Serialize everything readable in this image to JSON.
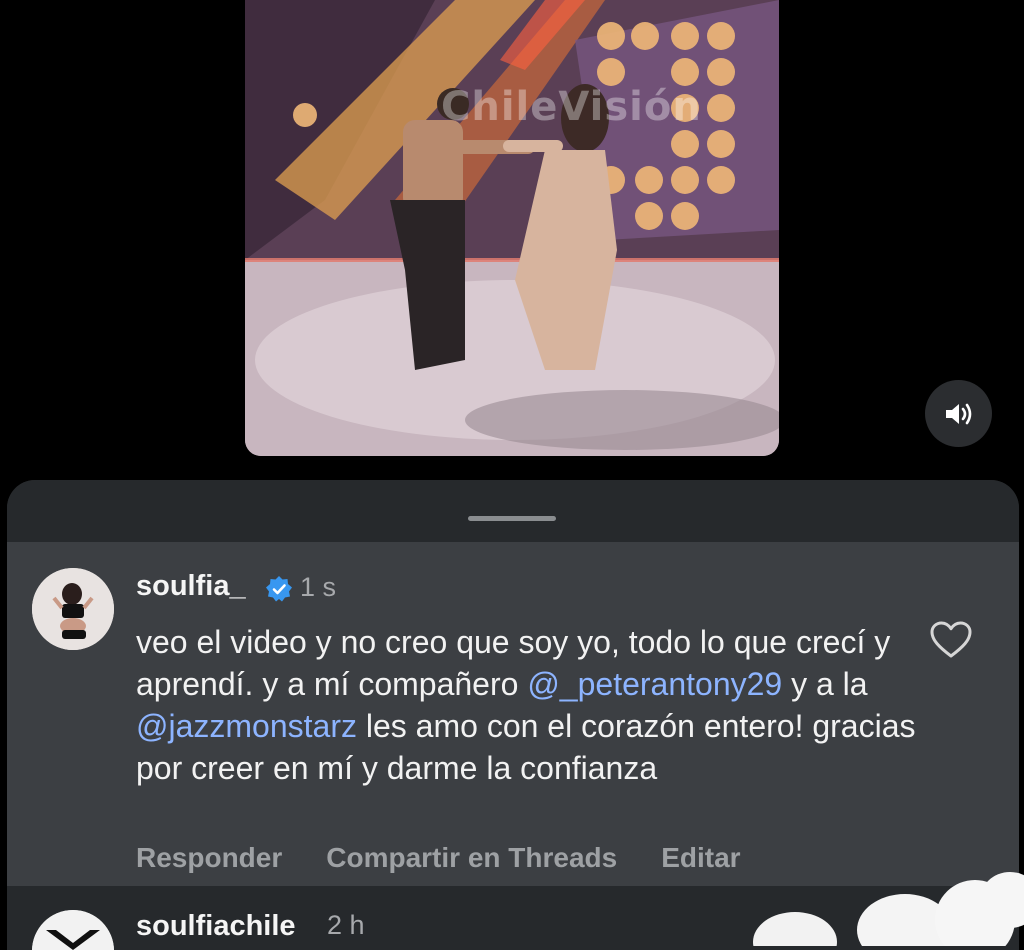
{
  "video": {
    "watermark": "ChileVisión",
    "sound_icon": "speaker-icon"
  },
  "comment": {
    "username": "soulfia_",
    "verified_icon": "verified-badge-icon",
    "time": "1 s",
    "text_parts": [
      "veo el video y no creo que soy yo, todo lo que crecí y aprendí. y a mí compañero ",
      "@_peterantony29",
      " y a la ",
      "@jazzmonstarz",
      " les amo con el corazón entero! gracias por creer en mí y darme la confianza"
    ],
    "like_icon": "heart-outline-icon",
    "actions": {
      "reply": "Responder",
      "share": "Compartir en Threads",
      "edit": "Editar"
    }
  },
  "next_comment": {
    "username": "soulfiachile",
    "time": "2 h"
  },
  "colors": {
    "sheet_bg": "#26292c",
    "highlight_bg": "#3c3f43",
    "mention": "#8db4ff",
    "verified": "#3897f0"
  }
}
